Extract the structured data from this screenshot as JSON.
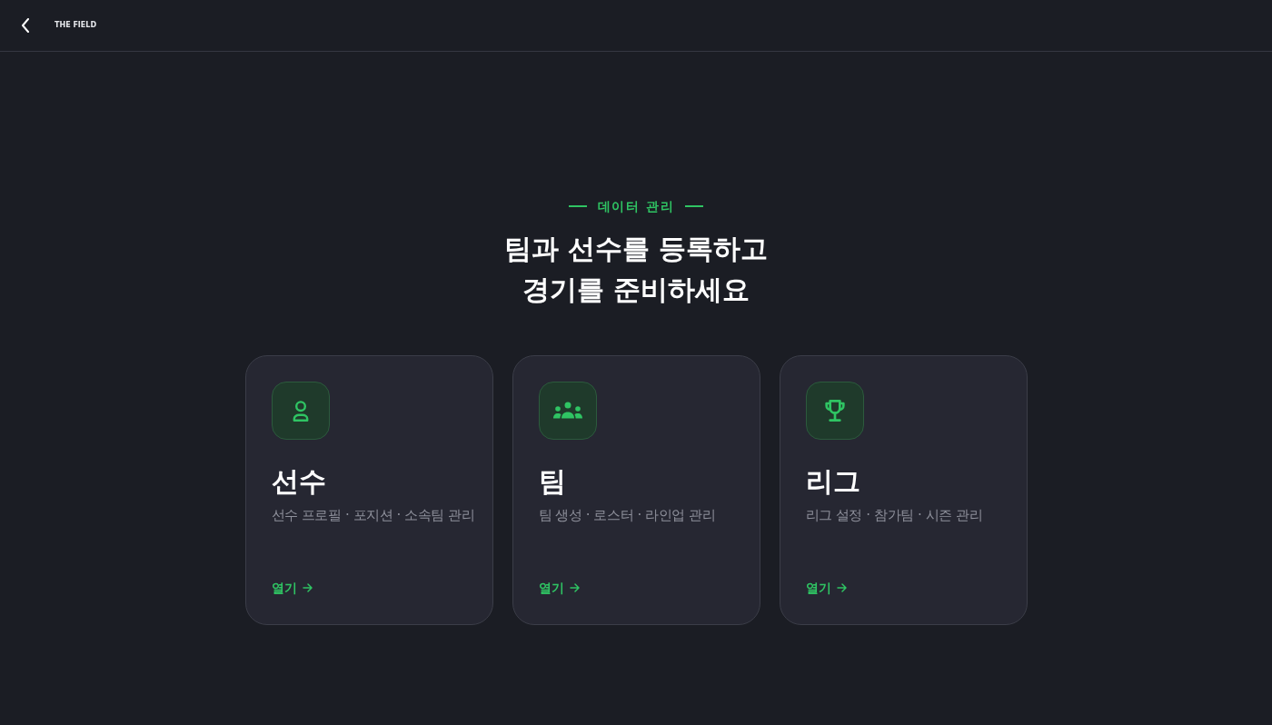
{
  "header": {
    "brand": "THE FIELD"
  },
  "hero": {
    "eyebrow": "데이터 관리",
    "title_lines": [
      "팀과 선수를 등록하고",
      "경기를 준비하세요"
    ]
  },
  "cards": [
    {
      "kind": "player",
      "title": "선수",
      "description": "선수 프로필 · 포지션 · 소속팀 관리",
      "link": "열기"
    },
    {
      "kind": "team",
      "title": "팀",
      "description": "팀 생성 · 로스터 · 라인업 관리",
      "link": "열기"
    },
    {
      "kind": "league",
      "title": "리그",
      "description": "리그 설정 · 참가팀 · 시즌 관리",
      "link": "열기"
    }
  ]
}
